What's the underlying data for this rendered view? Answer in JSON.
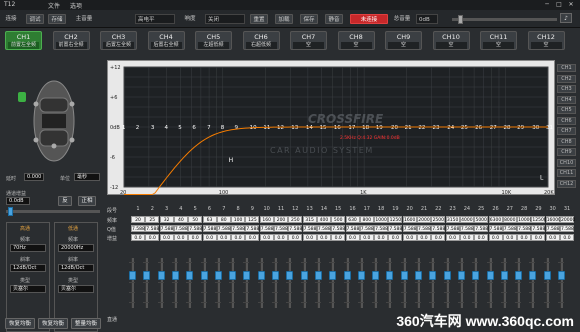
{
  "window": {
    "title": "T12",
    "menu": [
      "文件",
      "选项"
    ]
  },
  "toolbar": {
    "items_left": [
      "连接",
      "调试",
      "存储"
    ],
    "input_level_label": "主音量",
    "input_level_value": "高电平",
    "loudness_label": "响度",
    "loudness_value": "关闭",
    "reset_label": "重置",
    "load_label": "加载",
    "save_label": "保存",
    "mute_label": "静音",
    "disconnected_label": "未连接",
    "master_volume_label": "总音量",
    "master_volume_value": "0dB"
  },
  "channels": [
    {
      "name": "CH1",
      "sub": "前置左全频"
    },
    {
      "name": "CH2",
      "sub": "前置右全频"
    },
    {
      "name": "CH3",
      "sub": "后置左全频"
    },
    {
      "name": "CH4",
      "sub": "后置右全频"
    },
    {
      "name": "CH5",
      "sub": "左超低频"
    },
    {
      "name": "CH6",
      "sub": "右超低频"
    },
    {
      "name": "CH7",
      "sub": "空"
    },
    {
      "name": "CH8",
      "sub": "空"
    },
    {
      "name": "CH9",
      "sub": "空"
    },
    {
      "name": "CH10",
      "sub": "空"
    },
    {
      "name": "CH11",
      "sub": "空"
    },
    {
      "name": "CH12",
      "sub": "空"
    }
  ],
  "left_panel": {
    "delay_label": "延时",
    "delay_value": "0.000",
    "unit_label": "单位",
    "unit_value": "毫秒",
    "gain_label": "通道增益",
    "gain_value": "0.0dB",
    "reverse_label": "反",
    "phase_label": "正相",
    "hp_label": "高通",
    "lp_label": "低通",
    "freq_label": "频率",
    "hp_freq": "70Hz",
    "lp_freq": "20000Hz",
    "slope_label": "斜率",
    "hp_slope": "12dB/Oct",
    "lp_slope": "12dB/Oct",
    "type_label": "类型",
    "hp_type": "贝塞尔",
    "lp_type": "贝塞尔"
  },
  "graph": {
    "y_ticks": [
      "+12",
      "+6",
      "0dB",
      "-6",
      "-12"
    ],
    "x_ticks": [
      "20",
      "100",
      "1K",
      "10K",
      "20K"
    ],
    "logo_text": "CROSSFIRE",
    "watermark_sub": "CAR AUDIO SYSTEM",
    "point_labels": [
      "1",
      "2",
      "3",
      "4",
      "5",
      "6",
      "7",
      "8",
      "9",
      "10",
      "11",
      "12",
      "13",
      "14",
      "15",
      "16",
      "17",
      "18",
      "19",
      "20",
      "21",
      "22",
      "23",
      "24",
      "25",
      "26",
      "27",
      "28",
      "29",
      "30",
      "31"
    ],
    "h_marker": "H",
    "l_marker": "L",
    "selected_info": "2.5KHz Q:4.32 GAIN:0.0dB",
    "side_channels": [
      "CH1",
      "CH2",
      "CH3",
      "CH4",
      "CH5",
      "CH6",
      "CH7",
      "CH8",
      "CH9",
      "CH10",
      "CH11",
      "CH12"
    ]
  },
  "eq_table": {
    "row_labels": [
      "段号",
      "频率",
      "Q值",
      "增益"
    ],
    "indices": [
      "1",
      "2",
      "3",
      "4",
      "5",
      "6",
      "7",
      "8",
      "9",
      "10",
      "11",
      "12",
      "13",
      "14",
      "15",
      "16",
      "17",
      "18",
      "19",
      "20",
      "21",
      "22",
      "23",
      "24",
      "25",
      "26",
      "27",
      "28",
      "29",
      "30",
      "31"
    ],
    "freqs": [
      "20",
      "25",
      "32",
      "40",
      "50",
      "63",
      "80",
      "100",
      "125",
      "160",
      "200",
      "250",
      "315",
      "400",
      "500",
      "630",
      "800",
      "1000",
      "1250",
      "1600",
      "2000",
      "2500",
      "3150",
      "4000",
      "5000",
      "6300",
      "8000",
      "10000",
      "12500",
      "16000",
      "20000"
    ],
    "q": [
      "7.588",
      "7.588",
      "7.588",
      "7.588",
      "7.588",
      "7.588",
      "7.588",
      "7.588",
      "7.588",
      "7.588",
      "7.588",
      "7.588",
      "7.588",
      "7.588",
      "7.588",
      "7.588",
      "7.588",
      "7.588",
      "7.588",
      "7.588",
      "7.588",
      "7.588",
      "7.588",
      "7.588",
      "7.588",
      "7.588",
      "7.588",
      "7.588",
      "7.588",
      "7.588",
      "7.588"
    ],
    "gain": [
      "0.0",
      "0.0",
      "0.0",
      "0.0",
      "0.0",
      "0.0",
      "0.0",
      "0.0",
      "0.0",
      "0.0",
      "0.0",
      "0.0",
      "0.0",
      "0.0",
      "0.0",
      "0.0",
      "0.0",
      "0.0",
      "0.0",
      "0.0",
      "0.0",
      "0.0",
      "0.0",
      "0.0",
      "0.0",
      "0.0",
      "0.0",
      "0.0",
      "0.0",
      "0.0",
      "0.0"
    ],
    "bottom_label": "直通"
  },
  "bottom_buttons": [
    "恢复均衡",
    "恢复均衡",
    "整量均衡"
  ],
  "watermark": "360汽车网 www.360qc.com",
  "colors": {
    "active_channel": "#2e7d32",
    "curve": "#f57c00",
    "slider_knob": "#4aa3df",
    "disconnected": "#c8282a"
  }
}
